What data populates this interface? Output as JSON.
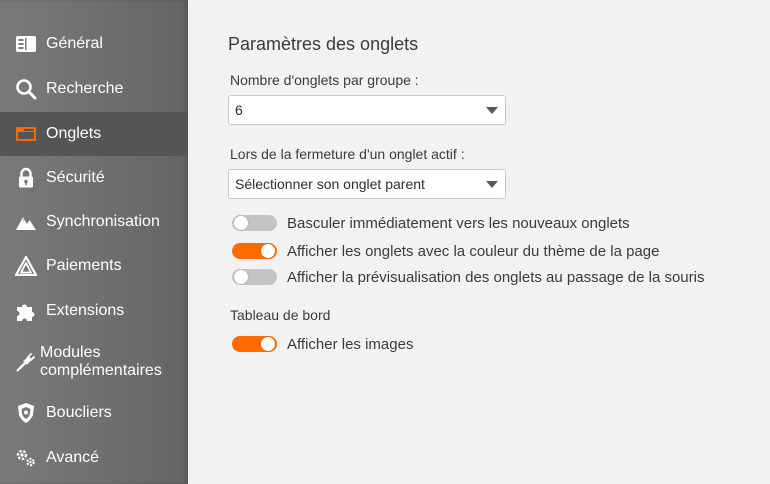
{
  "sidebar": {
    "items": [
      {
        "label": "Général",
        "icon": "general-icon",
        "active": false
      },
      {
        "label": "Recherche",
        "icon": "search-icon",
        "active": false
      },
      {
        "label": "Onglets",
        "icon": "tabs-icon",
        "active": true
      },
      {
        "label": "Sécurité",
        "icon": "lock-icon",
        "active": false
      },
      {
        "label": "Synchronisation",
        "icon": "sync-icon",
        "active": false
      },
      {
        "label": "Paiements",
        "icon": "payments-icon",
        "active": false
      },
      {
        "label": "Extensions",
        "icon": "puzzle-icon",
        "active": false
      },
      {
        "label": "Modules complémentaires",
        "icon": "plug-icon",
        "active": false
      },
      {
        "label": "Boucliers",
        "icon": "shield-icon",
        "active": false
      },
      {
        "label": "Avancé",
        "icon": "gears-icon",
        "active": false
      }
    ],
    "icon_color": "#ffffff",
    "active_icon_color": "#ff6a00"
  },
  "main": {
    "title": "Paramètres des onglets",
    "tabs_per_group": {
      "label": "Nombre d'onglets par groupe :",
      "value": "6"
    },
    "on_close": {
      "label": "Lors de la fermeture d'un onglet actif :",
      "value": "Sélectionner son onglet parent"
    },
    "toggles": [
      {
        "label": "Basculer immédiatement vers les nouveaux onglets",
        "on": false
      },
      {
        "label": "Afficher les onglets avec la couleur du thème de la page",
        "on": true
      },
      {
        "label": "Afficher la prévisualisation des onglets au passage de la souris",
        "on": false
      }
    ],
    "dashboard": {
      "label": "Tableau de bord",
      "toggle": {
        "label": "Afficher les images",
        "on": true
      }
    }
  },
  "colors": {
    "accent": "#ff6a00",
    "toggle_off": "#c4c4c4"
  }
}
